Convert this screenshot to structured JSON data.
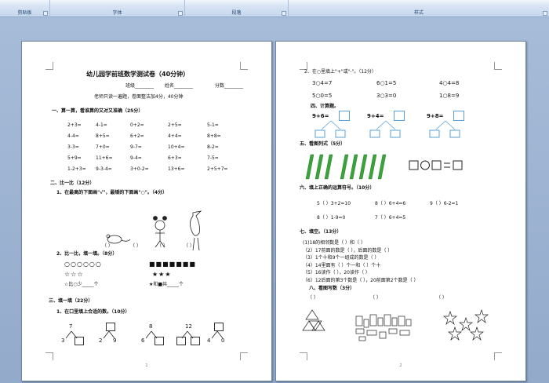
{
  "ribbon": {
    "groups": [
      "剪贴板",
      "字体",
      "段落",
      "样式"
    ]
  },
  "page1": {
    "title": "幼儿园学前班数学测试卷（40分钟）",
    "info": [
      "班级________",
      "姓名________",
      "分数________"
    ],
    "intro": "老师只读一遍题，卷面整洁加4分，40分钟",
    "s1_title": "一、算一算，看谁算的又对又准确（25分）",
    "s1_rows": [
      [
        "2+3=",
        "4-1=",
        "0+2=",
        "2+5=",
        "5-1="
      ],
      [
        "4-4=",
        "8+5=",
        "6+2=",
        "4+4=",
        "8+8="
      ],
      [
        "3-3=",
        "7+0=",
        "9-7=",
        "10+4=",
        "8-2="
      ],
      [
        "5+9=",
        "11+6=",
        "9-4=",
        "6+3=",
        "7-5="
      ],
      [
        "1-2+3=",
        "9-3-4=",
        "3+0-2=",
        "13+6=",
        "2+5+7="
      ]
    ],
    "s2_title": "二、比一比（12分）",
    "s2_q1": "1、在最高的下面画\"√\"，最矮的下面画\"○\"。（4分）",
    "s2_paren": [
      "（     ）",
      "（     ）",
      "（     ）",
      "（     ）"
    ],
    "s2_q2": "2、比一比，填一填。（8分）",
    "shapes": {
      "row1": "○○○○○○",
      "row2": "☆☆☆",
      "row3": "☆比○少_____个",
      "row4": "■■■■■■■",
      "row5": "★★★",
      "row6": "★和■共_____个"
    },
    "s3_title": "三、填一填（22分）",
    "s3_q1": "1、在口里填上合适的数。（10分）",
    "trees": [
      {
        "top": "7",
        "left": "3",
        "right": ""
      },
      {
        "top": "",
        "left": "2",
        "right": "9"
      },
      {
        "top": "8",
        "left": "6",
        "right": ""
      },
      {
        "top": "12",
        "left": "",
        "right": ""
      },
      {
        "top": "",
        "left": "4",
        "right": "0"
      }
    ],
    "number": "1"
  },
  "page2": {
    "q2": "2、在○里填上\"+\"或\"-\"。（12分）",
    "ops_rows": [
      [
        "3○4=7",
        "6○1=5",
        "4○4=8"
      ],
      [
        "5○0=5",
        "3○3=0",
        "1○8=9"
      ]
    ],
    "q4": "四、计算题。",
    "calc": [
      "9+6=",
      "9+4=",
      "9+8="
    ],
    "q5": "五、看图列式（5分）",
    "q6": "六、填上正确的运算符号。（10分）",
    "fill_row1": [
      "5（   ）3+2=10",
      "8（   ）6+4=6",
      "9（   ）6-2=1"
    ],
    "fill_row2": [
      "8（   ）1-9=0",
      "7（   ）6+4=5"
    ],
    "q7": "七、填空。（13分）",
    "q7_items": [
      "(1)18的相邻数是（    ）和（    ）",
      "（2）17前面的数是（   ），后面的数是（   ）",
      "（3）1个十和9个一组成的数是（    ）",
      "（4）14里面有（    ）个一和（    ）个十",
      "（5）16读作（      ），20读作（      ）",
      "（6）12后面的第3个数是（    ），20前面第2个数是（    ）"
    ],
    "q8": "八、看图写数（3分）",
    "q8_paren": [
      "（     ）",
      "（     ）",
      "（     ）"
    ],
    "number": "2"
  }
}
